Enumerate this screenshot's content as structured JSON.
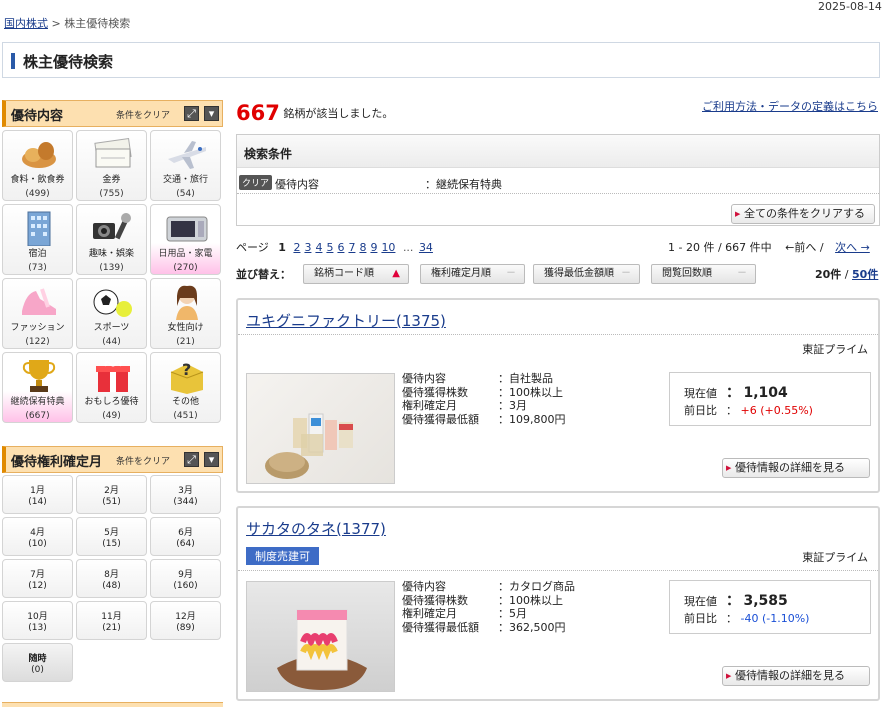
{
  "header": {
    "date": "2025-08-14 (",
    "breadcrumb_link": "国内株式",
    "breadcrumb_sep": " > ",
    "breadcrumb_current": "株主優待検索",
    "page_title": "株主優待検索"
  },
  "sidebar": {
    "category_section": {
      "title": "優待内容",
      "clear": "条件をクリア"
    },
    "categories": [
      {
        "label": "食料・飲食券",
        "count": "(499)",
        "icon": "bread-icon",
        "selected": false
      },
      {
        "label": "金券",
        "count": "(755)",
        "icon": "voucher-icon",
        "selected": false
      },
      {
        "label": "交通・旅行",
        "count": "(54)",
        "icon": "airplane-icon",
        "selected": false
      },
      {
        "label": "宿泊",
        "count": "(73)",
        "icon": "hotel-icon",
        "selected": false
      },
      {
        "label": "趣味・娯楽",
        "count": "(139)",
        "icon": "camera-icon",
        "selected": false
      },
      {
        "label": "日用品・家電",
        "count": "(270)",
        "icon": "microwave-icon",
        "selected": true
      },
      {
        "label": "ファッション",
        "count": "(122)",
        "icon": "shoe-icon",
        "selected": false
      },
      {
        "label": "スポーツ",
        "count": "(44)",
        "icon": "ball-icon",
        "selected": false
      },
      {
        "label": "女性向け",
        "count": "(21)",
        "icon": "woman-icon",
        "selected": false
      },
      {
        "label": "継続保有特典",
        "count": "(667)",
        "icon": "trophy-icon",
        "selected": true
      },
      {
        "label": "おもしろ優待",
        "count": "(49)",
        "icon": "gift-icon",
        "selected": false
      },
      {
        "label": "その他",
        "count": "(451)",
        "icon": "question-box-icon",
        "selected": false
      }
    ],
    "month_section": {
      "title": "優待権利確定月",
      "clear": "条件をクリア"
    },
    "months": [
      {
        "label": "1月",
        "count": "(14)"
      },
      {
        "label": "2月",
        "count": "(51)"
      },
      {
        "label": "3月",
        "count": "(344)"
      },
      {
        "label": "4月",
        "count": "(10)"
      },
      {
        "label": "5月",
        "count": "(15)"
      },
      {
        "label": "6月",
        "count": "(64)"
      },
      {
        "label": "7月",
        "count": "(12)"
      },
      {
        "label": "8月",
        "count": "(48)"
      },
      {
        "label": "9月",
        "count": "(160)"
      },
      {
        "label": "10月",
        "count": "(13)"
      },
      {
        "label": "11月",
        "count": "(21)"
      },
      {
        "label": "12月",
        "count": "(89)"
      },
      {
        "label": "随時",
        "count": "(0)"
      }
    ]
  },
  "main": {
    "result_count": "667",
    "result_suffix": "銘柄が該当しました。",
    "help_link": "ご利用方法・データの定義はこちら",
    "conditions": {
      "title": "検索条件",
      "clear_badge": "クリア",
      "key": "優待内容",
      "value": "：継続保有特典",
      "clear_all": "全ての条件をクリアする"
    },
    "pager": {
      "label": "ページ",
      "current": "1",
      "pages": [
        "2",
        "3",
        "4",
        "5",
        "6",
        "7",
        "8",
        "9",
        "10"
      ],
      "ellipsis": "...",
      "last": "34",
      "range": "1 - 20 件 / 667 件中",
      "prev": "←前へ",
      "sep": " / ",
      "next": "次へ →"
    },
    "sort": {
      "label": "並び替え：",
      "buttons": [
        {
          "label": "銘柄コード順",
          "mark": "▲",
          "active": true
        },
        {
          "label": "権利確定月順",
          "mark": "－",
          "active": false
        },
        {
          "label": "獲得最低金額順",
          "mark": "－",
          "active": false
        },
        {
          "label": "閲覧回数順",
          "mark": "－",
          "active": false
        }
      ],
      "per_page_current": "20件",
      "per_page_sep": " / ",
      "per_page_other": "50件"
    },
    "results": [
      {
        "name": "ユキグニファクトリー(1375)",
        "market": "東証プライム",
        "tag": "",
        "details": [
          {
            "k": "優待内容",
            "v": "：自社製品"
          },
          {
            "k": "優待獲得株数",
            "v": "：100株以上"
          },
          {
            "k": "権利確定月",
            "v": "：3月"
          },
          {
            "k": "優待獲得最低額",
            "v": "：109,800円"
          }
        ],
        "price_label": "現在値",
        "price_sep": "：",
        "price": "1,104",
        "change_label": "前日比",
        "change": "+6 (+0.55%)",
        "change_color": "#e00000",
        "detail_button": "優待情報の詳細を見る"
      },
      {
        "name": "サカタのタネ(1377)",
        "market": "東証プライム",
        "tag": "制度売建可",
        "details": [
          {
            "k": "優待内容",
            "v": "：カタログ商品"
          },
          {
            "k": "優待獲得株数",
            "v": "：100株以上"
          },
          {
            "k": "権利確定月",
            "v": "：5月"
          },
          {
            "k": "優待獲得最低額",
            "v": "：362,500円"
          }
        ],
        "price_label": "現在値",
        "price_sep": "：",
        "price": "3,585",
        "change_label": "前日比",
        "change": "-40 (-1.10%)",
        "change_color": "#1a4fd6",
        "detail_button": "優待情報の詳細を見る"
      }
    ]
  }
}
